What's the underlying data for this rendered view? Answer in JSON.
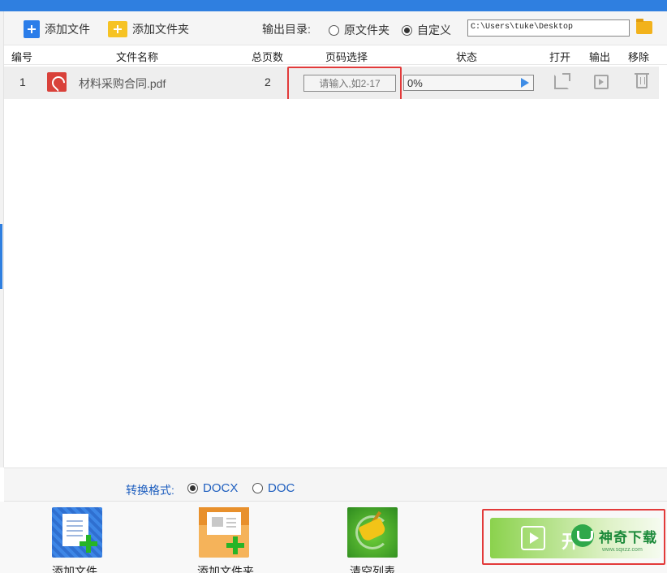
{
  "toolbar": {
    "add_file": "添加文件",
    "add_folder": "添加文件夹",
    "output_label": "输出目录:",
    "opt_source": "原文件夹",
    "opt_custom": "自定义",
    "output_path": "C:\\Users\\tuke\\Desktop"
  },
  "table": {
    "headers": {
      "index": "编号",
      "name": "文件名称",
      "pages": "总页数",
      "page_select": "页码选择",
      "status": "状态",
      "open": "打开",
      "output": "输出",
      "remove": "移除"
    },
    "rows": [
      {
        "index": "1",
        "name": "材料采购合同.pdf",
        "pages": "2",
        "page_placeholder": "请输入,如2-17",
        "progress_text": "0%",
        "progress": 0
      }
    ]
  },
  "format": {
    "label": "转换格式:",
    "docx": "DOCX",
    "doc": "DOC",
    "selected": "DOCX"
  },
  "bottom": {
    "add_file": "添加文件",
    "add_folder": "添加文件夹",
    "clear_list": "清空列表",
    "start": "开",
    "watermark_name": "神奇下载",
    "watermark_url": "www.sqxzz.com"
  },
  "colors": {
    "accent": "#2f7fe0",
    "highlight": "#e23a3a",
    "format_text": "#1f5fbf"
  }
}
